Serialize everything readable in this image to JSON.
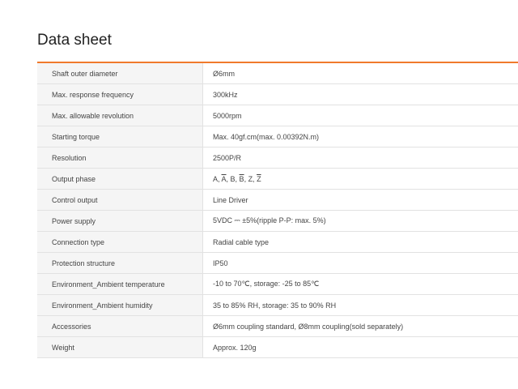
{
  "title": "Data sheet",
  "accent_color": "#f07a2c",
  "specs": [
    {
      "label": "Shaft outer diameter",
      "value": "Ø6mm"
    },
    {
      "label": "Max. response frequency",
      "value": "300kHz"
    },
    {
      "label": "Max. allowable revolution",
      "value": "5000rpm"
    },
    {
      "label": "Starting torque",
      "value": "Max. 40gf.cm(max. 0.00392N.m)"
    },
    {
      "label": "Resolution",
      "value": "2500P/R"
    },
    {
      "label": "Output phase",
      "value_parts": [
        "A, ",
        "A",
        ", B, ",
        "B",
        ", Z, ",
        "Z"
      ]
    },
    {
      "label": "Control output",
      "value": "Line Driver"
    },
    {
      "label": "Power supply",
      "value": "5VDC ⎓ ±5%(ripple P-P: max. 5%)"
    },
    {
      "label": "Connection type",
      "value": "Radial cable type"
    },
    {
      "label": "Protection structure",
      "value": "IP50"
    },
    {
      "label": "Environment_Ambient temperature",
      "value": "-10 to 70℃, storage: -25 to 85℃"
    },
    {
      "label": "Environment_Ambient humidity",
      "value": "35 to 85% RH, storage: 35 to 90% RH"
    },
    {
      "label": "Accessories",
      "value": "Ø6mm coupling standard, Ø8mm coupling(sold separately)"
    },
    {
      "label": "Weight",
      "value": "Approx. 120g"
    }
  ]
}
